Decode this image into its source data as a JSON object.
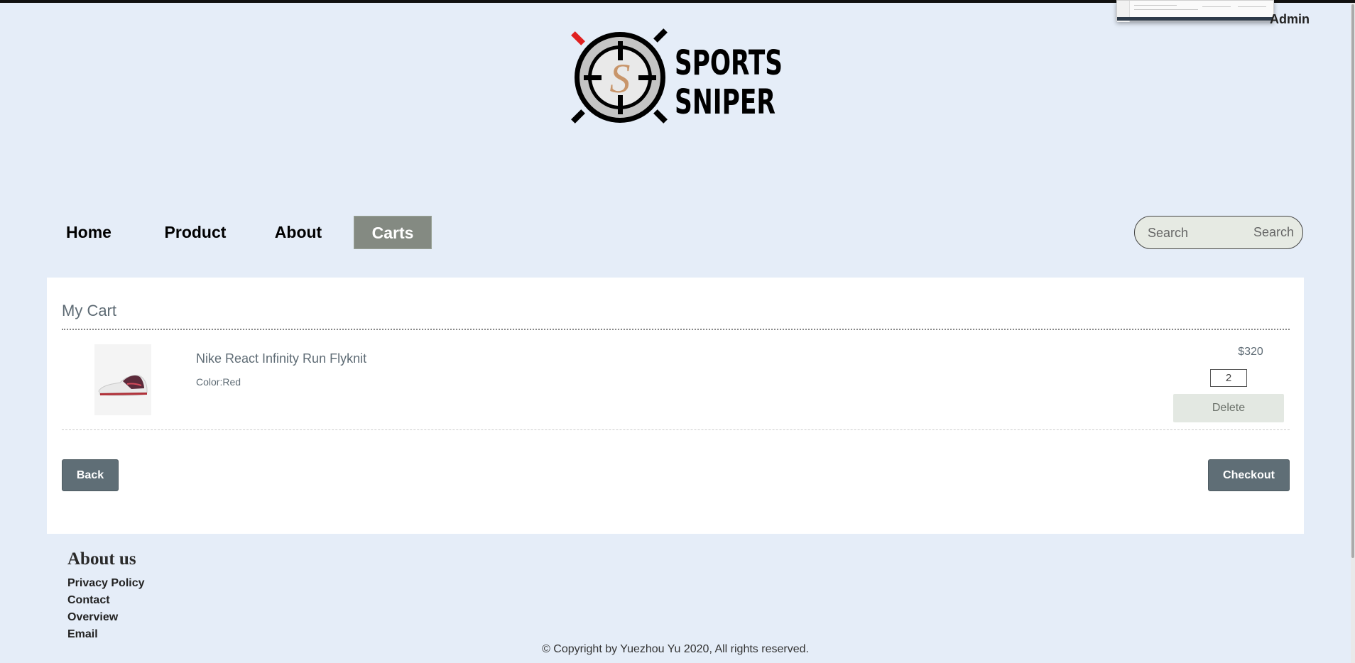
{
  "header": {
    "admin_label": "Admin",
    "logo": {
      "line1": "SPORTS",
      "line2": "SNIPER",
      "monogram": "S"
    }
  },
  "nav": {
    "items": [
      {
        "label": "Home",
        "active": false
      },
      {
        "label": "Product",
        "active": false
      },
      {
        "label": "About",
        "active": false
      },
      {
        "label": "Carts",
        "active": true
      }
    ]
  },
  "search": {
    "placeholder": "Search",
    "button_label": "Search"
  },
  "cart": {
    "title": "My Cart",
    "items": [
      {
        "name": "Nike React Infinity Run Flyknit",
        "color": "Color:Red",
        "price": "$320",
        "quantity": "2",
        "delete_label": "Delete"
      }
    ],
    "back_label": "Back",
    "checkout_label": "Checkout"
  },
  "footer": {
    "about_title": "About us",
    "links": [
      "Privacy Policy",
      "Contact",
      "Overview",
      "Email"
    ],
    "copyright": "© Copyright by Yuezhou Yu 2020, All rights reserved."
  },
  "colors": {
    "page_bg": "#e5edf8",
    "nav_active_bg": "#848a82",
    "primary_button": "#5f6e76",
    "muted_text": "#5e6b74",
    "logo_accent": "#c8956a",
    "logo_red": "#e02020"
  }
}
